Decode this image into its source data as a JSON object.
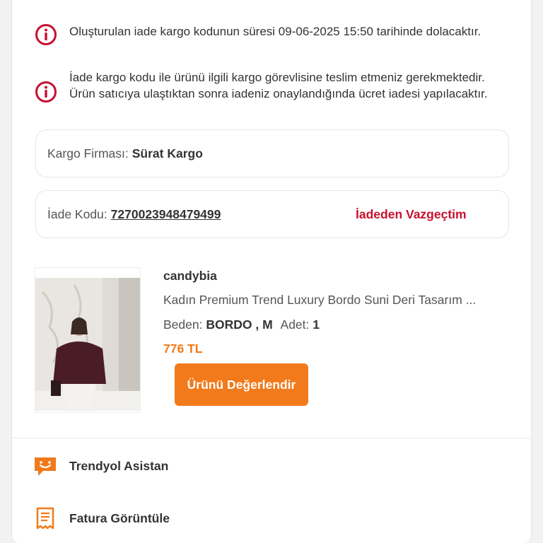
{
  "notices": [
    {
      "icon": "info-circle-icon",
      "text": "Oluşturulan iade kargo kodunun süresi 09-06-2025 15:50 tarihinde dolacaktır."
    },
    {
      "icon": "info-circle-icon",
      "text": "İade kargo kodu ile ürünü ilgili kargo görevlisine teslim etmeniz gerekmektedir. Ürün satıcıya ulaştıktan sonra iadeniz onaylandığında ücret iadesi yapılacaktır."
    }
  ],
  "shipping": {
    "label": "Kargo Firması:",
    "value": "Sürat Kargo"
  },
  "return": {
    "label": "İade Kodu:",
    "code": "7270023948479499",
    "cancel_label": "İadeden Vazgeçtim"
  },
  "product": {
    "seller": "candybia",
    "name": "Kadın Premium Trend Luxury Bordo Suni Deri Tasarım ...",
    "size_label": "Beden:",
    "size_value": "BORDO , M",
    "qty_label": "Adet:",
    "qty_value": "1",
    "price": "776 TL",
    "rate_button": "Ürünü Değerlendir"
  },
  "menu": [
    {
      "icon": "chat-assistant-icon",
      "label": "Trendyol Asistan"
    },
    {
      "icon": "invoice-icon",
      "label": "Fatura Görüntüle"
    }
  ],
  "colors": {
    "accent": "#f27a1a",
    "danger": "#c8102e"
  }
}
